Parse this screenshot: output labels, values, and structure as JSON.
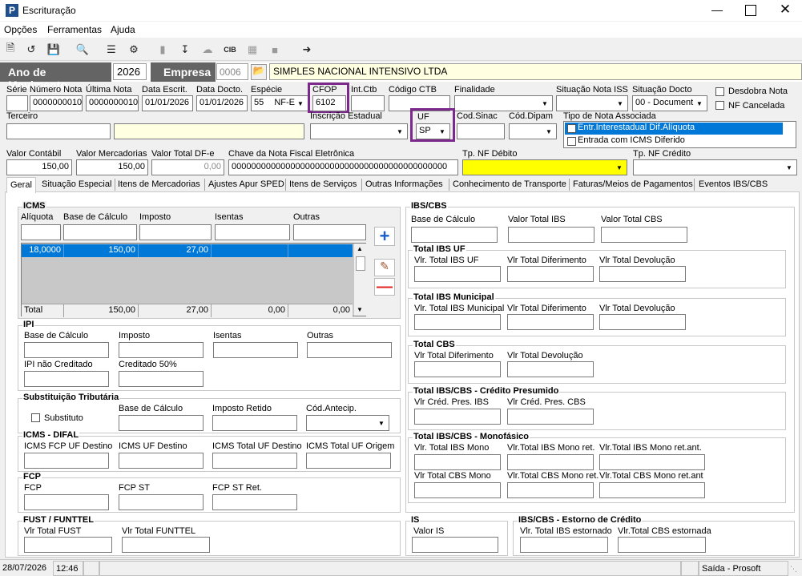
{
  "window": {
    "title": "Escrituração"
  },
  "menu": [
    "Opções",
    "Ferramentas",
    "Ajuda"
  ],
  "header": {
    "ano_label": "Ano de Movimento",
    "ano_value": "2026",
    "empresa_label": "Empresa",
    "empresa_code": "0006",
    "empresa_name": "SIMPLES NACIONAL INTENSIVO LTDA"
  },
  "fields": {
    "serie": {
      "label": "Série",
      "value": ""
    },
    "numero_nota": {
      "label": "Número Nota",
      "value": "0000000010"
    },
    "ultima_nota": {
      "label": "Última Nota",
      "value": "0000000010"
    },
    "data_escrit": {
      "label": "Data Escrit.",
      "value": "01/01/2026"
    },
    "data_docto": {
      "label": "Data Docto.",
      "value": "01/01/2026"
    },
    "especie": {
      "label": "Espécie",
      "code": "55",
      "value": "NF-E"
    },
    "cfop": {
      "label": "CFOP",
      "value": "6102"
    },
    "int_ctb": {
      "label": "Int.Ctb",
      "value": ""
    },
    "codigo_ctb": {
      "label": "Código CTB",
      "value": ""
    },
    "finalidade": {
      "label": "Finalidade",
      "value": ""
    },
    "situacao_iss": {
      "label": "Situação Nota ISS",
      "value": ""
    },
    "situacao_docto": {
      "label": "Situação Docto",
      "value": "00 - Document"
    },
    "desdobra_nota": {
      "label": "Desdobra Nota"
    },
    "nf_cancelada": {
      "label": "NF Cancelada"
    },
    "terceiro": {
      "label": "Terceiro",
      "value": ""
    },
    "inscricao_estadual": {
      "label": "Inscrição Estadual",
      "value": ""
    },
    "uf": {
      "label": "UF",
      "value": "SP"
    },
    "cod_sinac": {
      "label": "Cod.Sinac",
      "value": ""
    },
    "cod_dipam": {
      "label": "Cód.Dipam",
      "value": ""
    },
    "tipo_nota": {
      "label": "Tipo de Nota Associada",
      "options": [
        "Entr.Interestadual Dif.Alíquota",
        "Entrada com ICMS Diferido"
      ]
    },
    "valor_contabil": {
      "label": "Valor Contábil",
      "value": "150,00"
    },
    "valor_mercadorias": {
      "label": "Valor Mercadorias",
      "value": "150,00"
    },
    "valor_total_dfe": {
      "label": "Valor Total DF-e",
      "value": "0,00"
    },
    "chave_nfe": {
      "label": "Chave da Nota Fiscal Eletrônica",
      "value": "00000000000000000000000000000000000000000000"
    },
    "tp_nf_debito": {
      "label": "Tp. NF Débito",
      "value": ""
    },
    "tp_nf_credito": {
      "label": "Tp. NF Crédito",
      "value": ""
    }
  },
  "tabs": [
    "Geral",
    "Situação Especial",
    "Itens de Mercadorias",
    "Ajustes Apur SPED",
    "Itens de Serviços",
    "Outras Informações",
    "Conhecimento de Transporte",
    "Faturas/Meios de Pagamentos",
    "Eventos IBS/CBS"
  ],
  "icms": {
    "title": "ICMS",
    "cols": [
      "Alíquota",
      "Base de Cálculo",
      "Imposto",
      "Isentas",
      "Outras"
    ],
    "row": [
      "18,0000",
      "150,00",
      "27,00",
      "",
      ""
    ],
    "total": [
      "Total",
      "150,00",
      "27,00",
      "0,00",
      "0,00"
    ]
  },
  "ipi": {
    "title": "IPI",
    "labels": [
      "Base de Cálculo",
      "Imposto",
      "Isentas",
      "Outras",
      "IPI não Creditado",
      "Creditado 50%"
    ]
  },
  "st": {
    "title": "Substituição Tributária",
    "substituto": "Substituto",
    "labels": [
      "Base de Cálculo",
      "Imposto Retido",
      "Cód.Antecip."
    ]
  },
  "difal": {
    "title": "ICMS - DIFAL",
    "labels": [
      "ICMS FCP UF Destino",
      "ICMS UF Destino",
      "ICMS Total UF Destino",
      "ICMS Total UF Origem"
    ]
  },
  "fcp": {
    "title": "FCP",
    "labels": [
      "FCP",
      "FCP ST",
      "FCP ST Ret."
    ]
  },
  "fust": {
    "title": "FUST / FUNTTEL",
    "labels": [
      "Vlr Total FUST",
      "Vlr Total FUNTTEL"
    ]
  },
  "ibscbs": {
    "title": "IBS/CBS",
    "labels": [
      "Base de Cálculo",
      "Valor Total IBS",
      "Valor Total CBS"
    ]
  },
  "ibs_uf": {
    "title": "Total IBS UF",
    "labels": [
      "Vlr. Total IBS UF",
      "Vlr Total Diferimento",
      "Vlr Total Devolução"
    ]
  },
  "ibs_mun": {
    "title": "Total IBS Municipal",
    "labels": [
      "Vlr. Total IBS Municipal",
      "Vlr Total Diferimento",
      "Vlr Total Devolução"
    ]
  },
  "cbs": {
    "title": "Total CBS",
    "labels": [
      "Vlr Total Diferimento",
      "Vlr Total Devolução"
    ]
  },
  "presumido": {
    "title": "Total IBS/CBS - Crédito Presumido",
    "labels": [
      "Vlr Créd. Pres. IBS",
      "Vlr Créd. Pres. CBS"
    ]
  },
  "mono": {
    "title": "Total IBS/CBS - Monofásico",
    "labels": [
      "Vlr. Total IBS Mono",
      "Vlr.Total IBS Mono ret.",
      "Vlr.Total IBS Mono ret.ant.",
      "Vlr Total CBS Mono",
      "Vlr.Total CBS Mono ret.",
      "Vlr.Total CBS Mono ret.ant"
    ]
  },
  "is": {
    "title": "IS",
    "labels": [
      "Valor IS"
    ]
  },
  "estorno": {
    "title": "IBS/CBS - Estorno de Crédito",
    "labels": [
      "Vlr. Total IBS estornado",
      "Vlr.Total CBS estornada"
    ]
  },
  "status": {
    "date": "28/07/2026",
    "time": "12:46",
    "mode": "Saída - Prosoft"
  },
  "colors": {
    "accent": "#0078d7",
    "highlight": "#7b2a8b",
    "yellow": "#ffff00"
  }
}
